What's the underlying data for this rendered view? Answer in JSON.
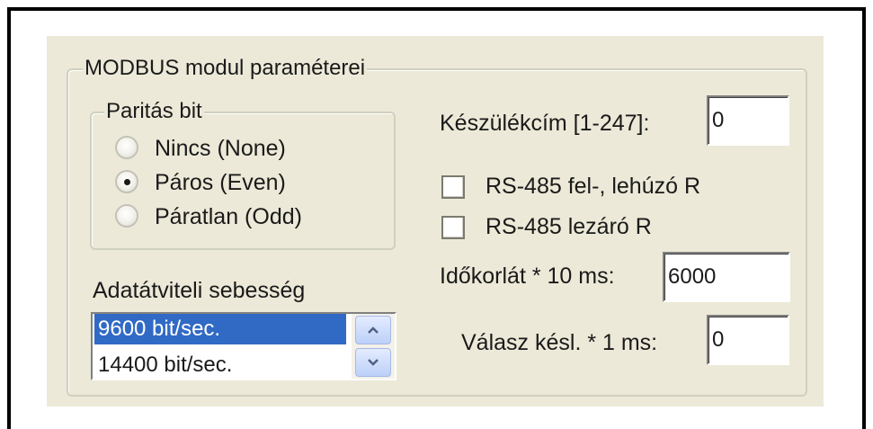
{
  "groupbox": {
    "title": "MODBUS modul paraméterei"
  },
  "parity": {
    "title": "Paritás bit",
    "options": [
      {
        "label": "Nincs (None)",
        "selected": false
      },
      {
        "label": "Páros (Even)",
        "selected": true
      },
      {
        "label": "Páratlan (Odd)",
        "selected": false
      }
    ]
  },
  "baud": {
    "label": "Adatátviteli sebesség",
    "items": [
      "9600 bit/sec.",
      "14400 bit/sec."
    ],
    "selected_index": 0
  },
  "device_address": {
    "label": "Készülékcím [1-247]:",
    "value": "0"
  },
  "checkboxes": [
    {
      "label": "RS-485 fel-, lehúzó R",
      "checked": false
    },
    {
      "label": "RS-485 lezáró R",
      "checked": false
    }
  ],
  "timeout": {
    "label": "Időkorlát * 10 ms:",
    "value": "6000"
  },
  "response_delay": {
    "label": "Válasz késl. * 1 ms:",
    "value": "0"
  },
  "colors": {
    "panel_bg": "#ece9d8",
    "selection": "#316ac5",
    "scroll_button": "#bcd0f8"
  },
  "icons": {
    "scroll_up": "chevron-up-icon",
    "scroll_down": "chevron-down-icon"
  }
}
